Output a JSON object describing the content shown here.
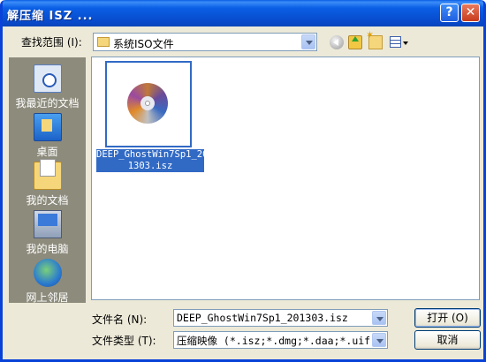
{
  "window": {
    "title": "解压缩 ISZ ..."
  },
  "toolbar": {
    "lookin_label": "查找范围 (I):",
    "lookin_value": "系统ISO文件"
  },
  "places": [
    {
      "label": "我最近的文档",
      "icon": "recent-documents-icon"
    },
    {
      "label": "桌面",
      "icon": "desktop-icon"
    },
    {
      "label": "我的文档",
      "icon": "my-documents-icon"
    },
    {
      "label": "我的电脑",
      "icon": "my-computer-icon"
    },
    {
      "label": "网上邻居",
      "icon": "network-places-icon"
    }
  ],
  "files": [
    {
      "name_line1": "DEEP_GhostWin7Sp1_20",
      "name_line2": "1303.isz",
      "icon": "disc-image-icon",
      "selected": true
    }
  ],
  "footer": {
    "filename_label": "文件名 (N):",
    "filename_value": "DEEP_GhostWin7Sp1_201303.isz",
    "filetype_label": "文件类型 (T):",
    "filetype_value": "压缩映像 (*.isz;*.dmg;*.daa;*.uif)",
    "open_label": "打开 (O)",
    "cancel_label": "取消"
  },
  "colors": {
    "titlebar": "#0a5fe5",
    "selection": "#316ac5",
    "places_bg": "#8d8b7c",
    "dialog_bg": "#ece9d8"
  }
}
